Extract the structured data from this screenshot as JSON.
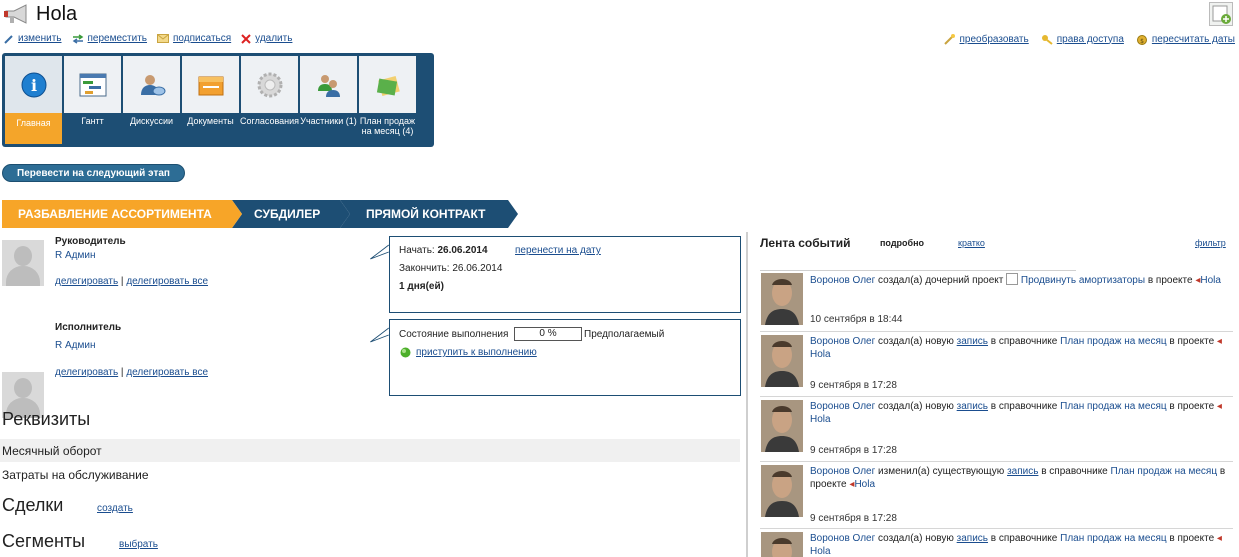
{
  "header": {
    "title": "Hola",
    "actions": [
      {
        "label": "изменить",
        "icon": "pencil-icon"
      },
      {
        "label": "переместить",
        "icon": "move-arrows-icon"
      },
      {
        "label": "подписаться",
        "icon": "envelope-icon"
      },
      {
        "label": "удалить",
        "icon": "delete-x-icon"
      }
    ],
    "right_actions": [
      {
        "label": "преобразовать",
        "icon": "wand-icon"
      },
      {
        "label": "права доступа",
        "icon": "key-icon"
      },
      {
        "label": "пересчитать даты",
        "icon": "recalc-icon"
      }
    ]
  },
  "tabs": [
    {
      "label": "Главная",
      "icon": "info-icon",
      "active": true
    },
    {
      "label": "Гантт",
      "icon": "gantt-icon"
    },
    {
      "label": "Дискуссии",
      "icon": "discussion-icon"
    },
    {
      "label": "Документы",
      "icon": "documents-icon"
    },
    {
      "label": "Согласования",
      "icon": "approval-gear-icon"
    },
    {
      "label": "Участники (1)",
      "icon": "participants-icon"
    },
    {
      "label": "План продаж на месяц (4)",
      "icon": "sales-plan-icon"
    }
  ],
  "next_stage_button": "Перевести на следующий этап",
  "stages": [
    "РАЗБАВЛЕНИЕ АССОРТИМЕНТА",
    "СУБДИЛЕР",
    "ПРЯМОЙ КОНТРАКТ"
  ],
  "manager": {
    "role": "Руководитель",
    "name": "R Админ",
    "delegate": "делегировать",
    "delegate_all": "делегировать все"
  },
  "executor": {
    "role": "Исполнитель",
    "name": "R Админ",
    "delegate": "делегировать",
    "delegate_all": "делегировать все"
  },
  "dates": {
    "start_label": "Начать:",
    "start_value": "26.06.2014",
    "move_link": "перенести на дату",
    "end_label": "Закончить:",
    "end_value": "26.06.2014",
    "duration": "1 дня(ей)"
  },
  "progress": {
    "label": "Состояние выполнения",
    "value": "0 %",
    "percent": 0,
    "expected": "Предполагаемый",
    "start_link": "приступить к выполнению"
  },
  "sections": {
    "requisites": "Реквизиты",
    "fields": [
      "Месячный оборот",
      "Затраты на обслуживание"
    ],
    "deals": "Сделки",
    "deals_link": "создать",
    "segments": "Сегменты",
    "segments_link": "выбрать"
  },
  "feed": {
    "title": "Лента событий",
    "mode_detailed": "подробно",
    "mode_brief": "кратко",
    "filter": "фильтр",
    "items": [
      {
        "author": "Воронов Олег",
        "action": "создал(а) дочерний проект",
        "target": "Продвинуть амортизаторы",
        "in_project": "в проекте",
        "project": "Hola",
        "time": "10 сентября в 18:44"
      },
      {
        "author": "Воронов Олег",
        "action": "создал(а) новую",
        "record": "запись",
        "in_ref": "в справочнике",
        "ref": "План продаж на месяц",
        "in_project": "в проекте",
        "project": "Hola",
        "time": "9 сентября в 17:28"
      },
      {
        "author": "Воронов Олег",
        "action": "создал(а) новую",
        "record": "запись",
        "in_ref": "в справочнике",
        "ref": "План продаж на месяц",
        "in_project": "в проекте",
        "project": "Hola",
        "time": "9 сентября в 17:28"
      },
      {
        "author": "Воронов Олег",
        "action": "изменил(а) существующую",
        "record": "запись",
        "in_ref": "в справочнике",
        "ref": "План продаж на месяц",
        "in_project": "в проекте",
        "project": "Hola",
        "time": "9 сентября в 17:28"
      },
      {
        "author": "Воронов Олег",
        "action": "создал(а) новую",
        "record": "запись",
        "in_ref": "в справочнике",
        "ref": "План продаж на месяц",
        "in_project": "в проекте",
        "project": "Hola",
        "time": ""
      }
    ]
  }
}
